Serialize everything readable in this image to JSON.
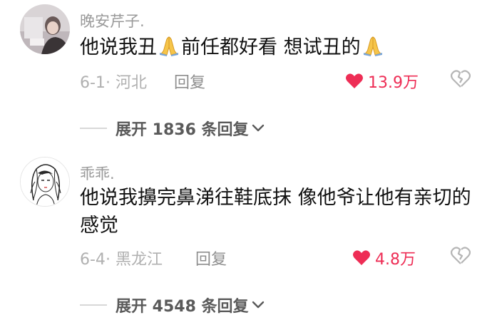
{
  "comments": [
    {
      "username": "晚安芹子.",
      "text_before_emoji": "他说我丑",
      "text_middle": "前任都好看 想试丑的",
      "emoji_icon": "folded-hands-emoji",
      "date": "6-1",
      "location": "河北",
      "reply_label": "回复",
      "likes": "13.9万",
      "expand_label": "展开 1836 条回复"
    },
    {
      "username": "乖乖.",
      "text": "他说我擤完鼻涕往鞋底抹 像他爷让他有亲切的感觉",
      "date": "6-4",
      "location": "黑龙江",
      "reply_label": "回复",
      "likes": "4.8万",
      "expand_label": "展开 4548 条回复"
    }
  ],
  "colors": {
    "like_red": "#ee2d55",
    "meta_gray": "#b0b0b0",
    "text": "#111111"
  }
}
